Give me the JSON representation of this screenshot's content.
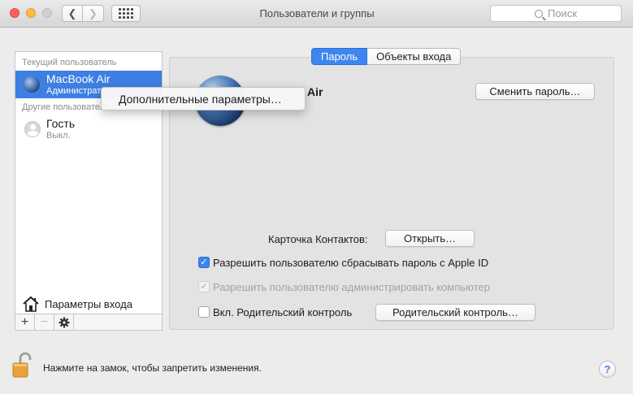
{
  "window": {
    "title": "Пользователи и группы",
    "search_placeholder": "Поиск"
  },
  "sidebar": {
    "current_header": "Текущий пользователь",
    "current_user": {
      "name": "MacBook Air",
      "role": "Администратор"
    },
    "other_header": "Другие пользователи",
    "other_users": [
      {
        "name": "Гость",
        "role": "Выкл."
      }
    ],
    "login_options_label": "Параметры входа",
    "add_label": "+",
    "remove_label": "−",
    "gear_icon": "gear-icon"
  },
  "context_menu": {
    "item": "Дополнительные параметры…"
  },
  "tabs": [
    {
      "label": "Пароль",
      "active": true
    },
    {
      "label": "Объекты входа",
      "active": false
    }
  ],
  "account": {
    "name_visible": "Air",
    "change_password_label": "Сменить пароль…"
  },
  "contacts": {
    "label": "Карточка Контактов:",
    "open_label": "Открыть…"
  },
  "options": [
    {
      "label": "Разрешить пользователю сбрасывать пароль с Apple ID",
      "checked": true,
      "enabled": true
    },
    {
      "label": "Разрешить пользователю администрировать компьютер",
      "checked": true,
      "enabled": false
    },
    {
      "label": "Вкл. Родительский контроль",
      "checked": false,
      "enabled": true
    }
  ],
  "parental_button_label": "Родительский контроль…",
  "footer": {
    "lock_text": "Нажмите на замок, чтобы запретить изменения.",
    "help_label": "?"
  },
  "colors": {
    "accent": "#3c86f0",
    "selection": "#3d7fe2"
  }
}
